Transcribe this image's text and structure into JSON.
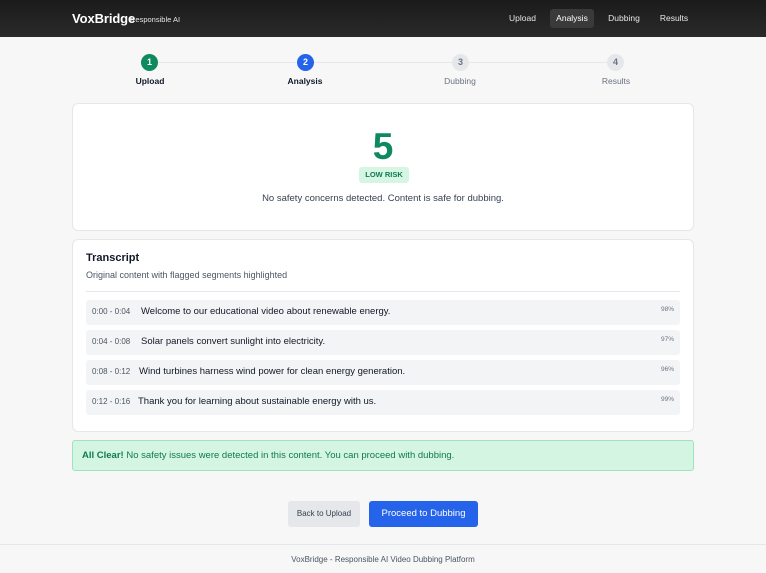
{
  "header": {
    "brand": "VoxBridge",
    "brand_sub": "Responsible AI",
    "nav": [
      "Upload",
      "Analysis",
      "Dubbing",
      "Results"
    ],
    "active_nav": "Analysis"
  },
  "steps": [
    {
      "number": "1",
      "label": "Upload",
      "state": "complete"
    },
    {
      "number": "2",
      "label": "Analysis",
      "state": "current"
    },
    {
      "number": "3",
      "label": "Dubbing",
      "state": "pending"
    },
    {
      "number": "4",
      "label": "Results",
      "state": "pending"
    }
  ],
  "safety": {
    "score": "5",
    "risk_label": "LOW RISK",
    "message": "No safety concerns detected. Content is safe for dubbing."
  },
  "transcript": {
    "title": "Transcript",
    "subtitle": "Original content with flagged segments highlighted",
    "segments": [
      {
        "time": "0:00 - 0:04",
        "text": "Welcome to our educational video about renewable energy.",
        "confidence": "98%"
      },
      {
        "time": "0:04 - 0:08",
        "text": "Solar panels convert sunlight into electricity.",
        "confidence": "97%"
      },
      {
        "time": "0:08 - 0:12",
        "text": "Wind turbines harness wind power for clean energy generation.",
        "confidence": "96%"
      },
      {
        "time": "0:12 - 0:16",
        "text": "Thank you for learning about sustainable energy with us.",
        "confidence": "99%"
      }
    ]
  },
  "alert": {
    "strong": "All Clear!",
    "message": "No safety issues were detected in this content. You can proceed with dubbing."
  },
  "actions": {
    "back": "Back to Upload",
    "proceed": "Proceed to Dubbing"
  },
  "footer": "VoxBridge - Responsible AI Video Dubbing Platform",
  "colors": {
    "complete": "#0f8a5f",
    "current": "#2563eb",
    "pending": "#e5e7eb",
    "success_bg": "#d4f5e2"
  }
}
